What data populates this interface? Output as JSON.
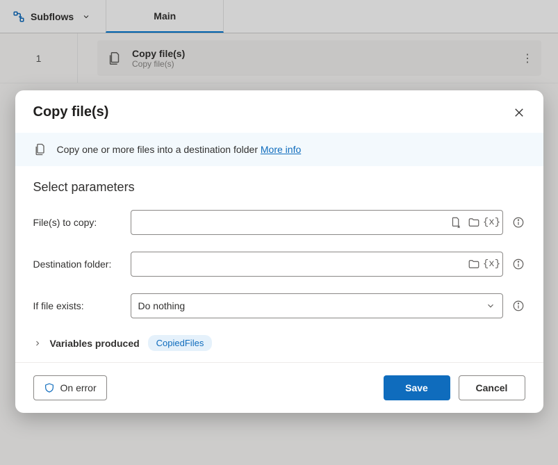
{
  "toolbar": {
    "subflows_label": "Subflows",
    "tab_label": "Main"
  },
  "designer": {
    "row_number": "1",
    "action_title": "Copy file(s)",
    "action_subtitle": "Copy file(s)"
  },
  "dialog": {
    "title": "Copy file(s)",
    "info_text": "Copy one or more files into a destination folder ",
    "more_info": "More info",
    "section_title": "Select parameters",
    "fields": {
      "files_label": "File(s) to copy:",
      "files_value": "",
      "dest_label": "Destination folder:",
      "dest_value": "",
      "exists_label": "If file exists:",
      "exists_value": "Do nothing"
    },
    "variables": {
      "label": "Variables produced",
      "chip": "CopiedFiles"
    },
    "buttons": {
      "on_error": "On error",
      "save": "Save",
      "cancel": "Cancel"
    }
  }
}
